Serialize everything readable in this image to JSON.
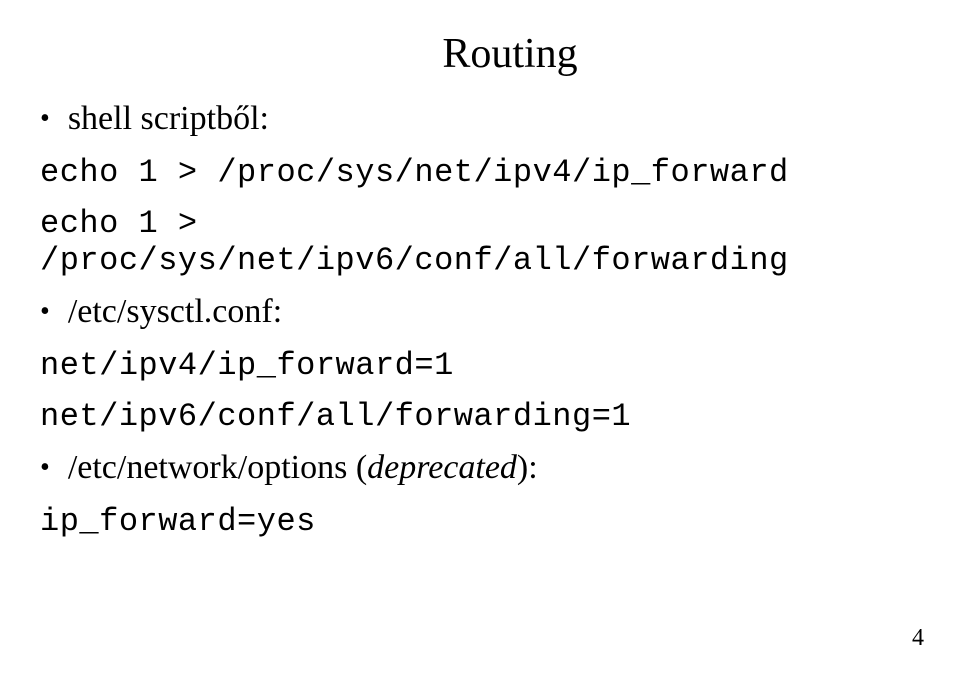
{
  "title": "Routing",
  "bullets": [
    {
      "label": "shell scriptből:",
      "code": [
        "echo 1 > /proc/sys/net/ipv4/ip_forward",
        "echo 1 > /proc/sys/net/ipv6/conf/all/forwarding"
      ]
    },
    {
      "label": "/etc/sysctl.conf:",
      "code": [
        "net/ipv4/ip_forward=1",
        "net/ipv6/conf/all/forwarding=1"
      ]
    },
    {
      "label_prefix": "/etc/network/options (",
      "label_italic": "deprecated",
      "label_suffix": "):",
      "code": [
        "ip_forward=yes"
      ]
    }
  ],
  "page_number": "4"
}
